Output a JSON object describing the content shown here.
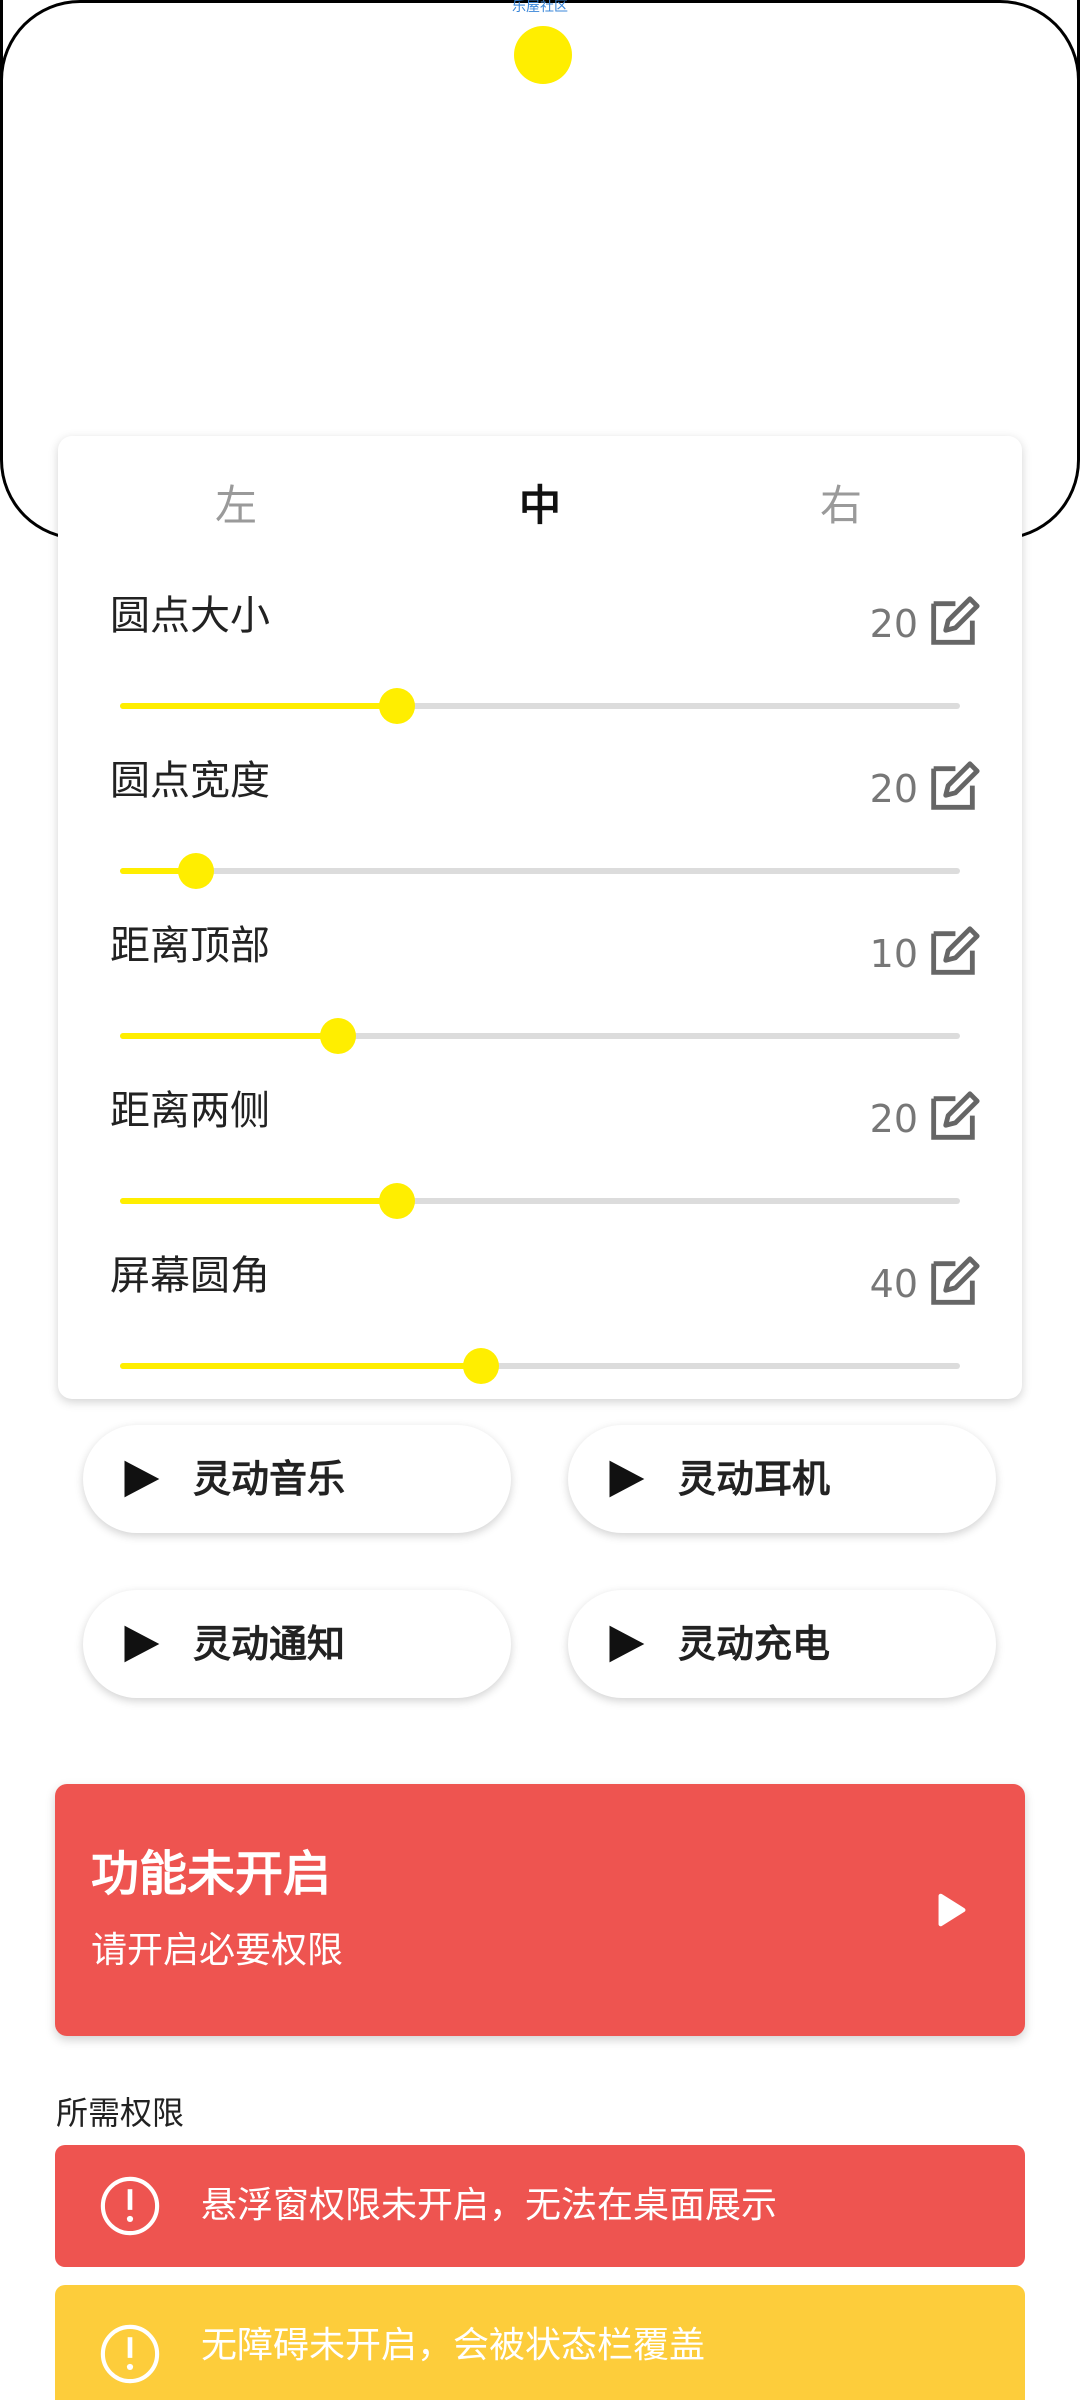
{
  "preview": {
    "top_text": "乐屋社区",
    "dot_color": "#ffee00"
  },
  "position_tabs": [
    {
      "label": "左",
      "active": false
    },
    {
      "label": "中",
      "active": true
    },
    {
      "label": "右",
      "active": false
    }
  ],
  "settings": [
    {
      "label": "圆点大小",
      "value": "20",
      "fraction": 0.33
    },
    {
      "label": "圆点宽度",
      "value": "20",
      "fraction": 0.09
    },
    {
      "label": "距离顶部",
      "value": "10",
      "fraction": 0.26
    },
    {
      "label": "距离两侧",
      "value": "20",
      "fraction": 0.33
    },
    {
      "label": "屏幕圆角",
      "value": "40",
      "fraction": 0.43
    }
  ],
  "effects": [
    {
      "label": "灵动音乐"
    },
    {
      "label": "灵动耳机"
    },
    {
      "label": "灵动通知"
    },
    {
      "label": "灵动充电"
    }
  ],
  "status": {
    "title": "功能未开启",
    "subtitle": "请开启必要权限"
  },
  "permissions": {
    "heading": "所需权限",
    "items": [
      {
        "text": "悬浮窗权限未开启，无法在桌面展示",
        "color": "#ee5450"
      },
      {
        "text": "无障碍未开启，会被状态栏覆盖",
        "color": "#fdcd3b"
      }
    ]
  },
  "colors": {
    "accent": "#ffee00",
    "danger": "#ee5450",
    "warning": "#fdcd3b"
  }
}
